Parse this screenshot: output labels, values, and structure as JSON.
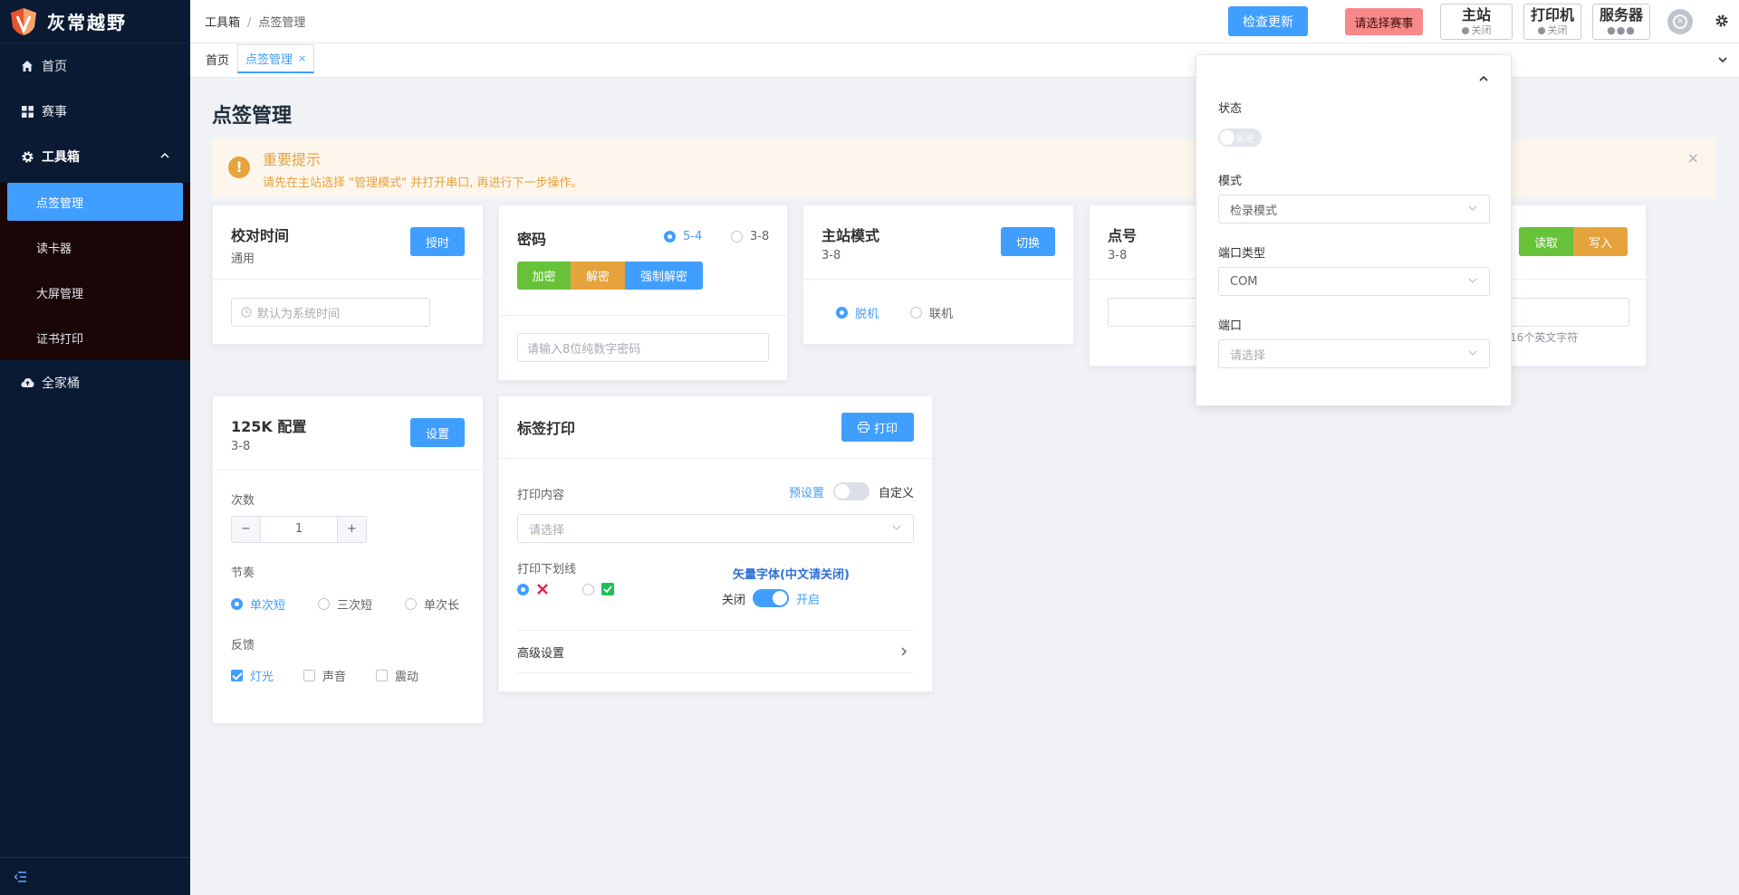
{
  "app": {
    "brand": "灰常越野"
  },
  "sidebar": {
    "items": [
      {
        "label": "首页",
        "icon": "home-icon"
      },
      {
        "label": "赛事",
        "icon": "grid-icon"
      },
      {
        "label": "工具箱",
        "icon": "gear-icon"
      },
      {
        "label": "全家桶",
        "icon": "cloud-icon"
      }
    ],
    "subitems": [
      {
        "label": "点签管理",
        "active": true
      },
      {
        "label": "读卡器"
      },
      {
        "label": "大屏管理"
      },
      {
        "label": "证书打印"
      }
    ]
  },
  "header": {
    "breadcrumb": [
      "工具箱",
      "点签管理"
    ],
    "separator": "/",
    "check_update": "检查更新",
    "select_event": "请选择赛事",
    "stations": [
      {
        "title": "主站",
        "status": "关闭"
      },
      {
        "title": "打印机",
        "status": "关闭"
      },
      {
        "title": "服务器",
        "status": "●●●"
      }
    ]
  },
  "tabs": [
    {
      "label": "首页"
    },
    {
      "label": "点签管理",
      "close": "×",
      "active": true
    }
  ],
  "page": {
    "title": "点签管理"
  },
  "alert": {
    "icon": "!",
    "title": "重要提示",
    "desc": "请先在主站选择 \"管理模式\" 并打开串口, 再进行下一步操作。",
    "close": "×"
  },
  "cards": {
    "time": {
      "title": "校对时间",
      "sub": "通用",
      "button": "授时",
      "placeholder": "默认为系统时间"
    },
    "password": {
      "title": "密码",
      "options": [
        "5-4",
        "3-8"
      ],
      "selected": "5-4",
      "btn_encrypt": "加密",
      "btn_decrypt": "解密",
      "btn_force": "强制解密",
      "placeholder": "请输入8位纯数字密码"
    },
    "master": {
      "title": "主站模式",
      "sub": "3-8",
      "button": "切换",
      "options": [
        "脱机",
        "联机"
      ],
      "selected": "脱机"
    },
    "point": {
      "title": "点号",
      "sub": "3-8"
    },
    "rw": {
      "btn_read": "读取",
      "btn_write": "写入",
      "hint": "16个英文字符"
    },
    "k125": {
      "title": "125K 配置",
      "sub": "3-8",
      "button": "设置",
      "count_label": "次数",
      "count_value": "1",
      "minus": "−",
      "plus": "+",
      "rhythm_label": "节奏",
      "rhythm_options": [
        "单次短",
        "三次短",
        "单次长"
      ],
      "rhythm_selected": "单次短",
      "feedback_label": "反馈",
      "feedback_options": [
        "灯光",
        "声音",
        "震动"
      ],
      "feedback_checked": [
        "灯光"
      ]
    },
    "label": {
      "title": "标签打印",
      "button": "打印",
      "content_label": "打印内容",
      "preset": "预设置",
      "custom": "自定义",
      "select_placeholder": "请选择",
      "underline_label": "打印下划线",
      "vector_label": "矢量字体(中文请关闭)",
      "off": "关闭",
      "on": "开启",
      "advanced": "高级设置"
    }
  },
  "popover": {
    "status_label": "状态",
    "status_switch": "关闭",
    "mode_label": "模式",
    "mode_value": "检录模式",
    "port_type_label": "端口类型",
    "port_type_value": "COM",
    "port_label": "端口",
    "port_placeholder": "请选择"
  },
  "colors": {
    "primary": "#409eff",
    "success": "#67c23a",
    "warning": "#e6a23c",
    "sidebar": "#0a1a33"
  }
}
